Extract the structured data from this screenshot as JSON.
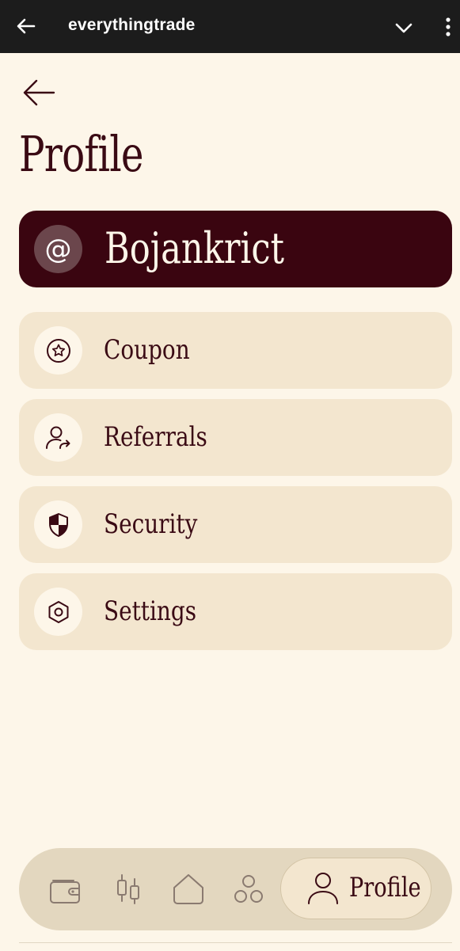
{
  "browser": {
    "title": "everythingtrade",
    "back_icon": "arrow-left-icon",
    "expand_icon": "chevron-down-icon",
    "menu_icon": "more-vertical-icon"
  },
  "page": {
    "back_icon": "arrow-left-icon",
    "title": "Profile"
  },
  "user": {
    "at_symbol": "@",
    "username": "Bojankrict"
  },
  "menu": [
    {
      "label": "Coupon",
      "icon": "star-badge-icon"
    },
    {
      "label": "Referrals",
      "icon": "user-share-icon"
    },
    {
      "label": "Security",
      "icon": "shield-icon"
    },
    {
      "label": "Settings",
      "icon": "hexagon-gear-icon"
    }
  ],
  "nav": {
    "items": [
      {
        "icon": "wallet-icon"
      },
      {
        "icon": "candlestick-icon"
      },
      {
        "icon": "home-icon"
      },
      {
        "icon": "coins-icon"
      }
    ],
    "active": {
      "label": "Profile",
      "icon": "user-icon"
    }
  },
  "colors": {
    "background": "#fdf6e9",
    "primary": "#3a0510",
    "card": "#f3e6cf",
    "nav": "#e3d7bf"
  }
}
